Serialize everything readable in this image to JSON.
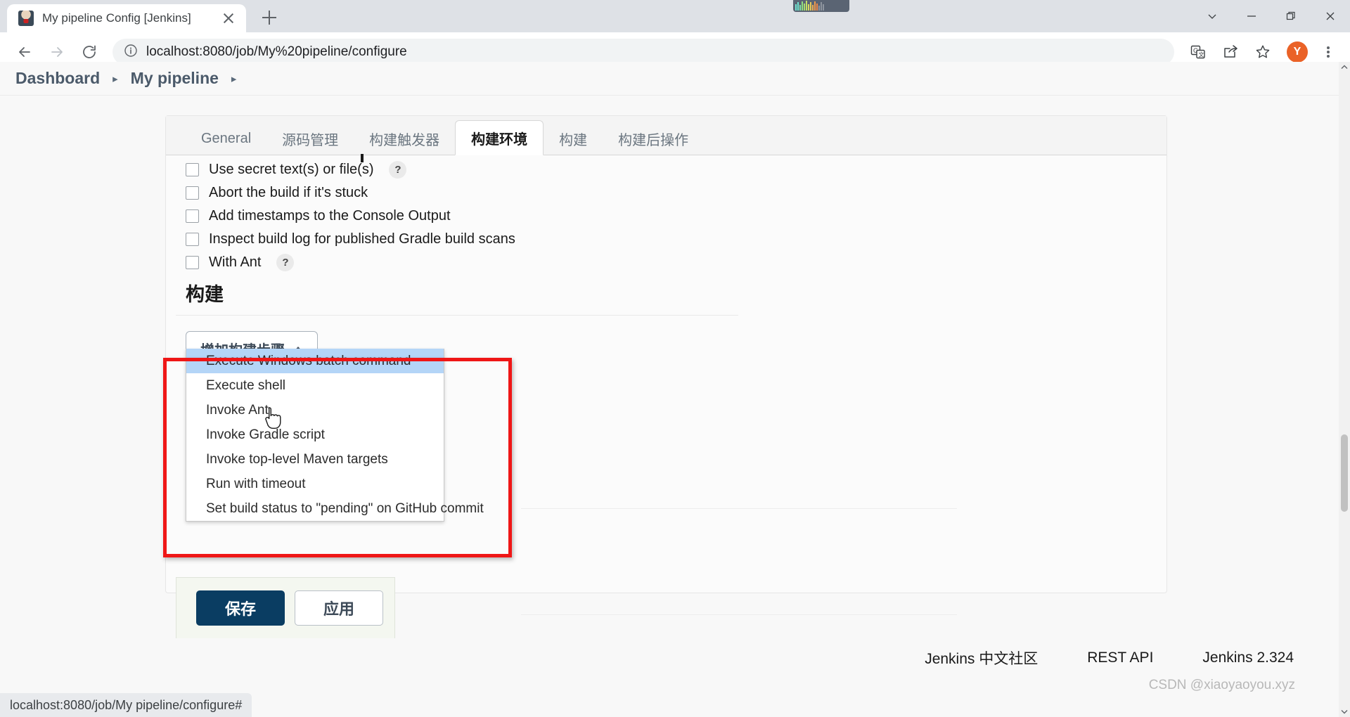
{
  "browser": {
    "tab": {
      "title": "My pipeline Config [Jenkins]",
      "favicon": "jenkins-butler-icon",
      "close": "×"
    },
    "new_tab_label": "+",
    "url": "localhost:8080/job/My%20pipeline/configure",
    "nav": {
      "back": "back-arrow",
      "forward": "forward-arrow",
      "reload": "reload-icon",
      "site_info": "info-circle-icon"
    },
    "toolbar_icons": [
      "translate-icon",
      "share-icon",
      "bookmark-star-icon"
    ],
    "profile_initial": "Y",
    "menu": "three-dot-menu",
    "window_controls": [
      "chevron-down",
      "minimize",
      "restore",
      "close"
    ],
    "status_text": "localhost:8080/job/My pipeline/configure#"
  },
  "breadcrumb": {
    "items": [
      {
        "label": "Dashboard"
      },
      {
        "label": "My pipeline"
      }
    ],
    "separator": "▸"
  },
  "config": {
    "tabs": [
      {
        "label": "General",
        "active": false
      },
      {
        "label": "源码管理",
        "active": false
      },
      {
        "label": "构建触发器",
        "active": false
      },
      {
        "label": "构建环境",
        "active": true
      },
      {
        "label": "构建",
        "active": false
      },
      {
        "label": "构建后操作",
        "active": false
      }
    ],
    "environment_checkboxes": [
      {
        "label": "Use secret text(s) or file(s)",
        "checked": false,
        "help": "?"
      },
      {
        "label": "Abort the build if it's stuck",
        "checked": false,
        "help": ""
      },
      {
        "label": "Add timestamps to the Console Output",
        "checked": false,
        "help": ""
      },
      {
        "label": "Inspect build log for published Gradle build scans",
        "checked": false,
        "help": ""
      },
      {
        "label": "With Ant",
        "checked": false,
        "help": "?"
      }
    ],
    "build_section": {
      "title": "构建",
      "add_step_button": "增加构建步骤",
      "add_step_caret": "caret-up-icon",
      "dropdown_open": true,
      "dropdown_items": [
        {
          "label": "Execute Windows batch command",
          "selected": true
        },
        {
          "label": "Execute shell",
          "selected": false
        },
        {
          "label": "Invoke Ant",
          "selected": false
        },
        {
          "label": "Invoke Gradle script",
          "selected": false
        },
        {
          "label": "Invoke top-level Maven targets",
          "selected": false
        },
        {
          "label": "Run with timeout",
          "selected": false
        },
        {
          "label": "Set build status to \"pending\" on GitHub commit",
          "selected": false
        }
      ]
    },
    "actions": {
      "save": "保存",
      "apply": "应用"
    }
  },
  "page_footer": {
    "community": "Jenkins 中文社区",
    "rest_api": "REST API",
    "version": "Jenkins 2.324",
    "watermark": "CSDN @xiaoyaoyou.xyz"
  },
  "annotation": {
    "type": "red-highlight-box",
    "color": "#ef1616"
  }
}
